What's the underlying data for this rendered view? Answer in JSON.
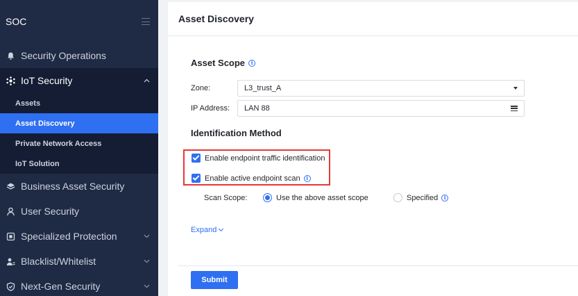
{
  "sidebar": {
    "brand": "SOC",
    "items": [
      {
        "label": "Security Operations",
        "icon": "bell-icon"
      },
      {
        "label": "IoT Security",
        "icon": "iot-icon",
        "open": true
      },
      {
        "label": "Business Asset Security",
        "icon": "layers-icon"
      },
      {
        "label": "User Security",
        "icon": "user-icon"
      },
      {
        "label": "Specialized Protection",
        "icon": "shield-grid-icon"
      },
      {
        "label": "Blacklist/Whitelist",
        "icon": "user-list-icon"
      },
      {
        "label": "Next-Gen Security",
        "icon": "shield-check-icon"
      }
    ],
    "sub_items": [
      {
        "label": "Assets"
      },
      {
        "label": "Asset Discovery",
        "active": true
      },
      {
        "label": "Private Network Access"
      },
      {
        "label": "IoT Solution"
      }
    ]
  },
  "main": {
    "title": "Asset Discovery",
    "asset_scope": {
      "heading": "Asset Scope",
      "zone_label": "Zone:",
      "zone_value": "L3_trust_A",
      "ip_label": "IP Address:",
      "ip_value": "LAN 88"
    },
    "identification": {
      "heading": "Identification Method",
      "option1": "Enable endpoint traffic identification",
      "option2": "Enable active endpoint scan",
      "scan_scope_label": "Scan Scope:",
      "scope_option1": "Use the above asset scope",
      "scope_option2": "Specified"
    },
    "expand_label": "Expand",
    "submit_label": "Submit"
  },
  "colors": {
    "sidebar_bg": "#1f2a44",
    "accent": "#2f6ff1",
    "highlight": "#e53935"
  }
}
